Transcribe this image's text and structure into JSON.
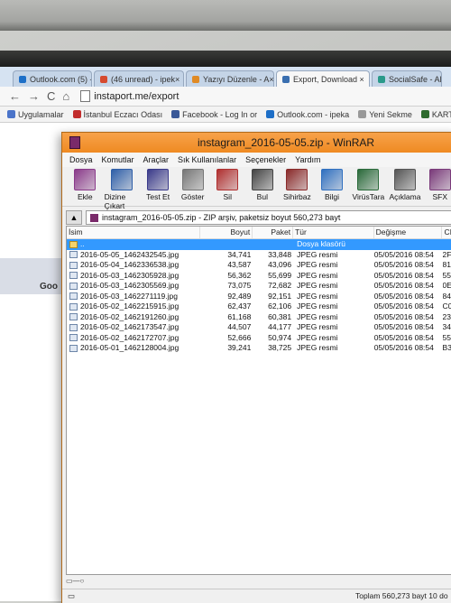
{
  "browser": {
    "tabs": [
      {
        "label": "Outlook.com (5) - ×",
        "color": "#1e6fc7"
      },
      {
        "label": "(46 unread) - ipek×",
        "color": "#d64a2f"
      },
      {
        "label": "Yazıyı Düzenle - A×",
        "color": "#e08a24"
      },
      {
        "label": "Export, Download ×",
        "color": "#3a6fb0",
        "active": true
      },
      {
        "label": "SocialSafe - All y×",
        "color": "#2a9a8a"
      }
    ],
    "back": "←",
    "forward": "→",
    "reload": "C",
    "home": "⌂",
    "url": "instaport.me/export",
    "bookmarks": [
      {
        "label": "Uygulamalar",
        "color": "#4b74c9"
      },
      {
        "label": "İstanbul Eczacı Odası",
        "color": "#c22d2d"
      },
      {
        "label": "Facebook - Log In or",
        "color": "#3b5998"
      },
      {
        "label": "Outlook.com - ipeka",
        "color": "#1e6fc7"
      },
      {
        "label": "Yeni Sekme",
        "color": "#999999"
      },
      {
        "label": "KARTAL DOĞA",
        "color": "#2d6b2d"
      }
    ],
    "page_fragment": "Goo"
  },
  "winrar": {
    "title": "instagram_2016-05-05.zip - WinRAR",
    "menu": [
      "Dosya",
      "Komutlar",
      "Araçlar",
      "Sık Kullanılanlar",
      "Seçenekler",
      "Yardım"
    ],
    "tools": [
      {
        "label": "Ekle",
        "icon": "add-icon",
        "color": "#8a3a8a"
      },
      {
        "label": "Dizine Çıkart",
        "icon": "extract-icon",
        "color": "#2f5fa8"
      },
      {
        "label": "Test Et",
        "icon": "test-icon",
        "color": "#3a3a8a"
      },
      {
        "label": "Göster",
        "icon": "view-icon",
        "color": "#777777"
      },
      {
        "label": "Sil",
        "icon": "delete-icon",
        "color": "#b03030"
      },
      {
        "label": "Bul",
        "icon": "find-icon",
        "color": "#444444"
      },
      {
        "label": "Sihirbaz",
        "icon": "wizard-icon",
        "color": "#8a2a2a"
      },
      {
        "label": "Bilgi",
        "icon": "info-icon",
        "color": "#3070c0"
      },
      {
        "label": "VirüsTara",
        "icon": "virus-scan-icon",
        "color": "#2a6a3a"
      },
      {
        "label": "Açıklama",
        "icon": "comment-icon",
        "color": "#555555"
      },
      {
        "label": "SFX",
        "icon": "sfx-icon",
        "color": "#7a3a7a"
      }
    ],
    "path": "instagram_2016-05-05.zip - ZIP arşiv, paketsiz boyut 560,273 bayt",
    "columns": {
      "name": "İsim",
      "size": "Boyut",
      "packed": "Paket",
      "type": "Tür",
      "modified": "Değişme",
      "crc": "CI"
    },
    "folder_row": {
      "name": "..",
      "type": "Dosya klasörü"
    },
    "files": [
      {
        "name": "2016-05-05_1462432545.jpg",
        "size": "34,741",
        "packed": "33,848",
        "type": "JPEG resmi",
        "modified": "05/05/2016 08:54",
        "crc": "2F"
      },
      {
        "name": "2016-05-04_1462336538.jpg",
        "size": "43,587",
        "packed": "43,096",
        "type": "JPEG resmi",
        "modified": "05/05/2016 08:54",
        "crc": "81"
      },
      {
        "name": "2016-05-03_1462305928.jpg",
        "size": "56,362",
        "packed": "55,699",
        "type": "JPEG resmi",
        "modified": "05/05/2016 08:54",
        "crc": "55"
      },
      {
        "name": "2016-05-03_1462305569.jpg",
        "size": "73,075",
        "packed": "72,682",
        "type": "JPEG resmi",
        "modified": "05/05/2016 08:54",
        "crc": "0E"
      },
      {
        "name": "2016-05-03_1462271119.jpg",
        "size": "92,489",
        "packed": "92,151",
        "type": "JPEG resmi",
        "modified": "05/05/2016 08:54",
        "crc": "84"
      },
      {
        "name": "2016-05-02_1462215915.jpg",
        "size": "62,437",
        "packed": "62,106",
        "type": "JPEG resmi",
        "modified": "05/05/2016 08:54",
        "crc": "C0"
      },
      {
        "name": "2016-05-02_1462191260.jpg",
        "size": "61,168",
        "packed": "60,381",
        "type": "JPEG resmi",
        "modified": "05/05/2016 08:54",
        "crc": "23"
      },
      {
        "name": "2016-05-02_1462173547.jpg",
        "size": "44,507",
        "packed": "44,177",
        "type": "JPEG resmi",
        "modified": "05/05/2016 08:54",
        "crc": "34"
      },
      {
        "name": "2016-05-02_1462172707.jpg",
        "size": "52,666",
        "packed": "50,974",
        "type": "JPEG resmi",
        "modified": "05/05/2016 08:54",
        "crc": "55"
      },
      {
        "name": "2016-05-01_1462128004.jpg",
        "size": "39,241",
        "packed": "38,725",
        "type": "JPEG resmi",
        "modified": "05/05/2016 08:54",
        "crc": "B3"
      }
    ],
    "status_total": "Toplam 560,273 bayt 10 do"
  }
}
